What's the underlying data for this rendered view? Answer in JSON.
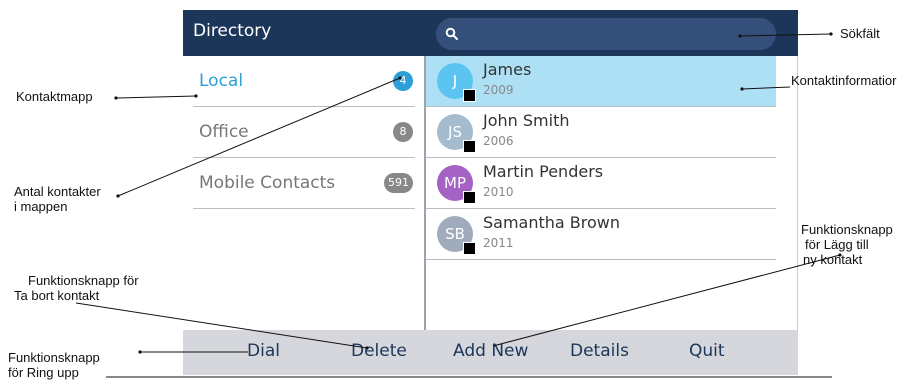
{
  "header": {
    "title": "Directory",
    "search_placeholder": "",
    "search_icon": "search-icon"
  },
  "folders": [
    {
      "label": "Local",
      "count": "4",
      "active": true
    },
    {
      "label": "Office",
      "count": "8",
      "active": false
    },
    {
      "label": "Mobile Contacts",
      "count": "591",
      "active": false
    }
  ],
  "contacts": [
    {
      "initials": "J",
      "name": "James",
      "sub": "2009",
      "color": "#5bc4f0",
      "selected": true
    },
    {
      "initials": "JS",
      "name": "John Smith",
      "sub": "2006",
      "color": "#a5bccf",
      "selected": false
    },
    {
      "initials": "MP",
      "name": "Martin Penders",
      "sub": "2010",
      "color": "#a463c4",
      "selected": false
    },
    {
      "initials": "SB",
      "name": "Samantha Brown",
      "sub": "2011",
      "color": "#a0acbc",
      "selected": false
    }
  ],
  "softkeys": [
    "Dial",
    "Delete",
    "Add New",
    "Details",
    "Quit"
  ],
  "callouts": {
    "kontaktmapp": "Kontaktmapp",
    "antal_line1": "Antal kontakter",
    "antal_line2": "i mappen",
    "ta_bort_line1": "Funktionsknapp för",
    "ta_bort_line2": "Ta bort kontakt",
    "ring_line1": "Funktionsknapp",
    "ring_line2": "för Ring upp",
    "sokfalt": "Sökfält",
    "kontaktinfo": "Kontaktinformatior",
    "lagg_line1": "Funktionsknapp",
    "lagg_line2": "för Lägg till",
    "lagg_line3": "ny kontakt"
  },
  "colors": {
    "header_bg": "#1c365a",
    "accent": "#2c9fd6",
    "selected_row": "#aee0f5",
    "softbar": "#d5d7dc"
  }
}
